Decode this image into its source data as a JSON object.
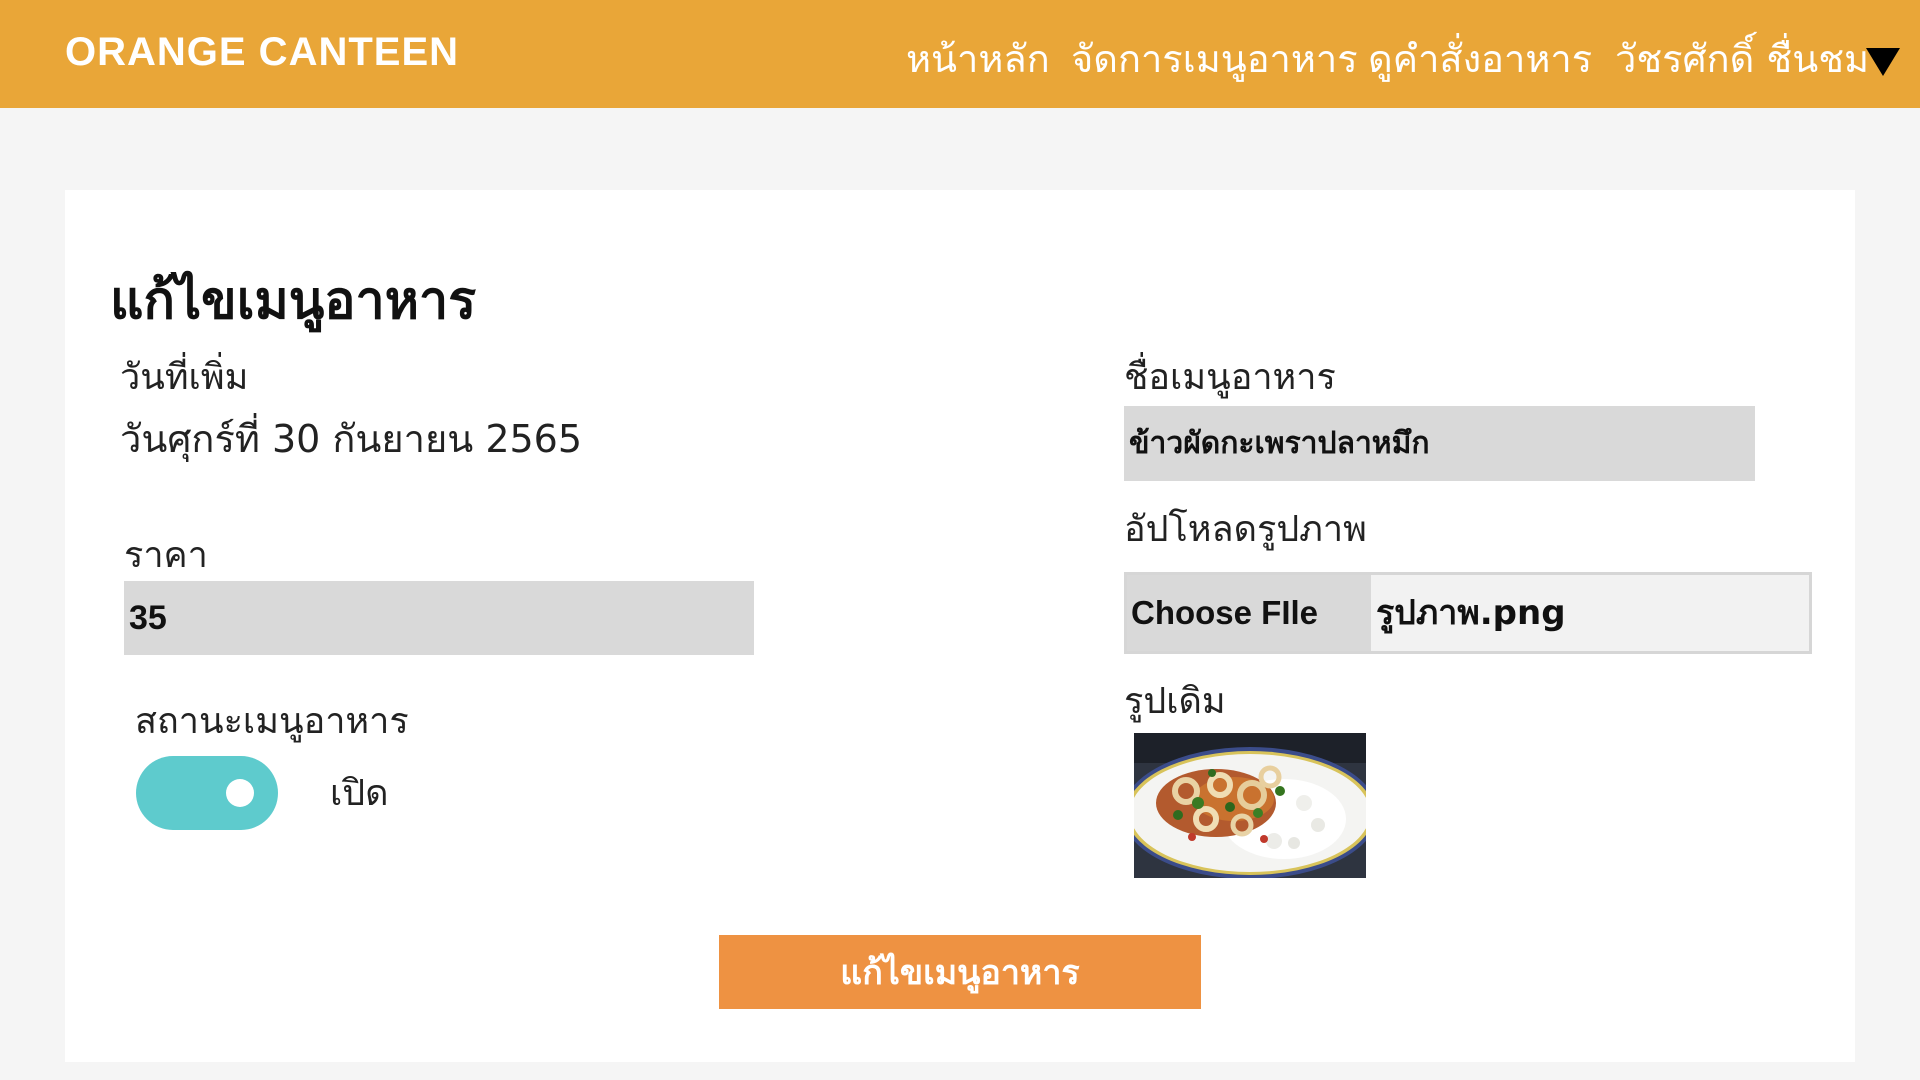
{
  "header": {
    "brand": "ORANGE CANTEEN",
    "nav": {
      "home": "หน้าหลัก",
      "manage_menu": "จัดการเมนูอาหาร",
      "view_orders": "ดูคำสั่งอาหาร",
      "user_name": "วัชรศักดิ์ ชื่นชม"
    },
    "user_dropdown_icon": "triangle-down-icon"
  },
  "form": {
    "title": "แก้ไขเมนูอาหาร",
    "date_added_label": "วันที่เพิ่ม",
    "date_added_value": "วันศุกร์ที่ 30 กันยายน 2565",
    "price_label": "ราคา",
    "price_value": "35",
    "status_label": "สถานะเมนูอาหาร",
    "status_on": true,
    "status_text": "เปิด",
    "name_label": "ชื่อเมนูอาหาร",
    "name_value": "ข้าวผัดกะเพราปลาหมึก",
    "upload_label": "อัปโหลดรูปภาพ",
    "choose_file_label": "Choose FIle",
    "file_name": "รูปภาพ.png",
    "old_image_label": "รูปเดิม",
    "submit_label": "แก้ไขเมนูอาหาร"
  },
  "colors": {
    "header_bg": "#e9a638",
    "toggle_on": "#5ecbcd",
    "submit_bg": "#ee9242",
    "input_bg": "#d9d9d9",
    "page_bg": "#f5f5f5"
  }
}
